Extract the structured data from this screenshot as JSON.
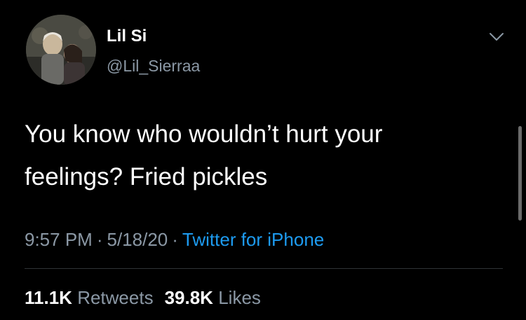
{
  "user": {
    "display_name": "Lil Si",
    "handle": "@Lil_Sierraa",
    "avatar_icon": "profile-photo"
  },
  "tweet": {
    "text_line1": "You know who wouldn’t hurt your",
    "text_line2": "feelings? Fried pickles"
  },
  "meta": {
    "time": "9:57 PM",
    "separator": "·",
    "date": "5/18/20",
    "source": "Twitter for iPhone"
  },
  "stats": {
    "retweets_count": "11.1K",
    "retweets_label": "Retweets",
    "likes_count": "39.8K",
    "likes_label": "Likes"
  },
  "colors": {
    "background": "#000000",
    "text_primary": "#ffffff",
    "text_secondary": "#8b98a5",
    "link": "#1d9bf0",
    "divider": "#2f3336"
  },
  "icons": {
    "menu": "chevron-down-icon"
  }
}
